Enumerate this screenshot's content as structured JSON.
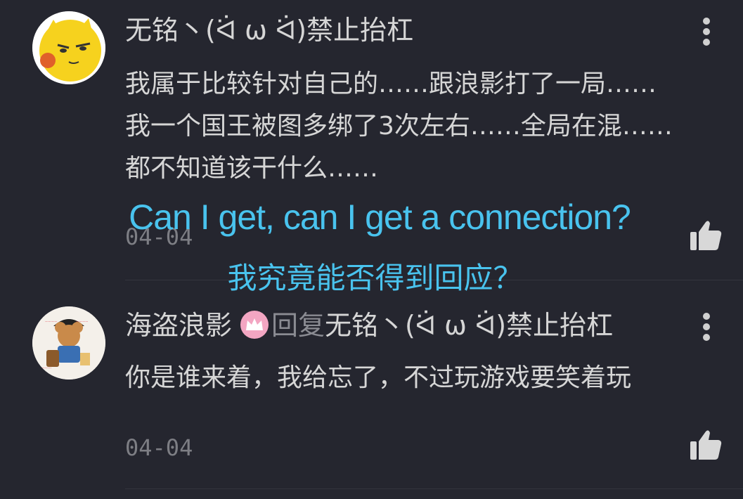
{
  "comments": [
    {
      "username": "无铭丶(ᐛ ω ᐛ)禁止抬杠",
      "lines": [
        "我属于比较针对自己的……跟浪影打了一局……",
        "我一个国王被图多绑了3次左右……全局在混……",
        "都不知道该干什么……"
      ],
      "date": "04-04",
      "avatar_icon": "yellow-cartoon-face-avatar",
      "more_icon": "vertical-dots-icon",
      "like_icon": "thumbs-up-icon"
    },
    {
      "username": "海盗浪影",
      "badge_icon": "crown-icon",
      "reply_word": "回复",
      "reply_to": "无铭丶(ᐛ ω ᐛ)禁止抬杠",
      "lines": [
        "你是谁来着，我给忘了，不过玩游戏要笑着玩"
      ],
      "date": "04-04",
      "avatar_icon": "pirate-mouse-avatar",
      "more_icon": "vertical-dots-icon",
      "like_icon": "thumbs-up-icon"
    }
  ],
  "subtitles": {
    "english": "Can I get, can I get a connection?",
    "chinese": "我究竟能否得到回应？",
    "color": "#49c3ee"
  },
  "colors": {
    "background": "#25262f",
    "badge": "#f3a6c2"
  }
}
